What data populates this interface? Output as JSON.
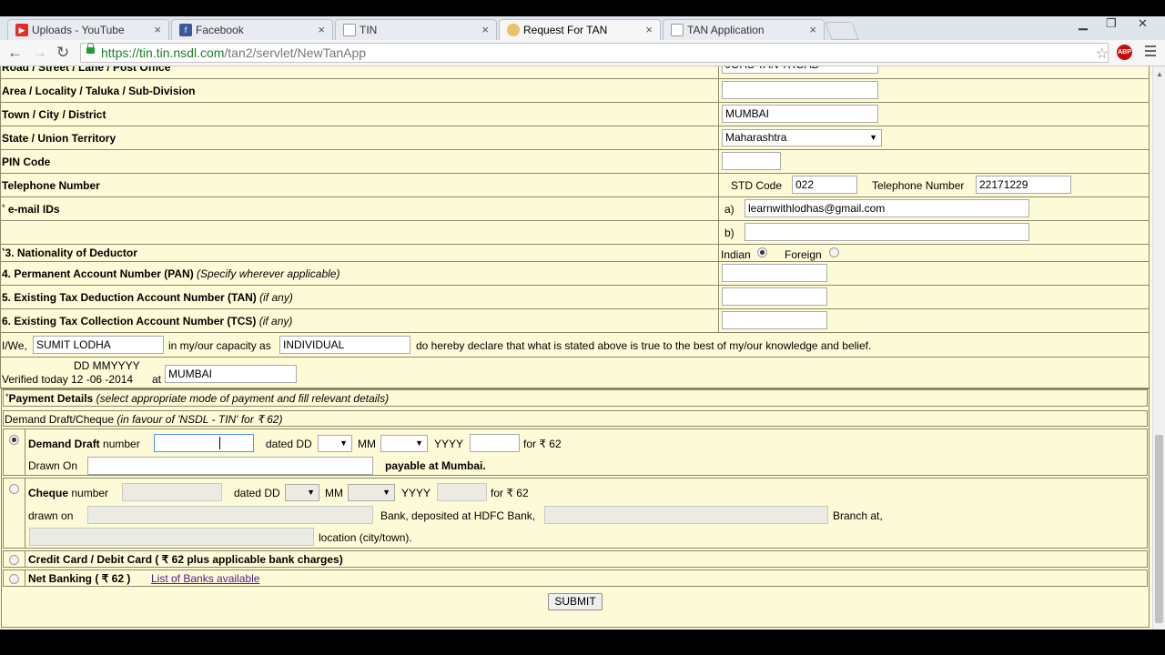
{
  "browser": {
    "tabs": [
      {
        "title": "Uploads - YouTube",
        "icon": "youtube-icon"
      },
      {
        "title": "Facebook",
        "icon": "facebook-icon"
      },
      {
        "title": "TIN",
        "icon": "page-icon"
      },
      {
        "title": "Request For TAN",
        "icon": "loading-icon"
      },
      {
        "title": "TAN Application",
        "icon": "page-icon"
      }
    ],
    "close_glyph": "×",
    "url_scheme": "https://",
    "url_host": "tin.tin.nsdl.com",
    "url_path": "/tan2/servlet/NewTanApp",
    "abp_label": "ABP"
  },
  "form": {
    "road_label": "Road / Street / Lane / Post Office",
    "road_value": "JOHS TAN TROAD",
    "area_label": "Area / Locality / Taluka / Sub-Division",
    "area_value": "",
    "town_label": "Town / City / District",
    "town_value": "MUMBAI",
    "state_label": "State / Union Territory",
    "state_value": "Maharashtra",
    "pin_label": "PIN Code",
    "pin_value": "",
    "telephone_label": "Telephone Number",
    "std_label": "STD Code",
    "std_value": "022",
    "tel_label": "Telephone Number",
    "tel_value": "22171229",
    "email_label": "e-mail IDs",
    "email_star": "*",
    "email_a_label": "a)",
    "email_a_value": "learnwithlodhas@gmail.com",
    "email_b_label": "b)",
    "email_b_value": "",
    "nationality_label": "3.   Nationality of Deductor",
    "nationality_star": "*",
    "nationality_indian": "Indian",
    "nationality_foreign": "Foreign",
    "pan_label": "4. Permanent Account Number (PAN)",
    "pan_note": "(Specify wherever applicable)",
    "tan_label": "5. Existing Tax Deduction Account Number (TAN)",
    "tan_note": "(if any)",
    "tcs_label": "6. Existing Tax Collection Account Number (TCS)",
    "tcs_note": "(if any)",
    "declaration_prefix": "I/We,",
    "declarant_name": "SUMIT LODHA",
    "capacity_text": "in my/our capacity as",
    "capacity_value": "INDIVIDUAL",
    "declaration_suffix": "do hereby declare that what is stated above is true to the best of my/our knowledge and belief.",
    "date_format": "DD MMYYYY",
    "verified_text": "Verified today  12 -06 -2014",
    "at_text": "at",
    "place_value": "MUMBAI"
  },
  "payment": {
    "header_star": "*",
    "header_label": "Payment Details",
    "header_note": "(select appropriate mode of payment and fill relevant details)",
    "dd_header": "Demand Draft/Cheque",
    "dd_header_note": "(in favour of 'NSDL - TIN' for ₹ 62)",
    "dd_label": "Demand Draft",
    "number_text": "number",
    "dated_dd": "dated DD",
    "mm": "MM",
    "yyyy": "YYYY",
    "for_amount": "for ₹ 62",
    "drawn_on_label": "Drawn On",
    "payable_text": "payable at Mumbai.",
    "cheque_label": "Cheque",
    "cheque_drawn_on": "drawn on",
    "bank_deposited": "Bank, deposited at HDFC Bank,",
    "branch_at": "Branch at,",
    "location_text": "location (city/town).",
    "credit_card": "Credit Card / Debit Card ( ₹ 62  plus applicable bank charges)",
    "net_banking": "Net Banking ( ₹ 62 )",
    "banks_link": "List of Banks available",
    "submit": "SUBMIT"
  }
}
